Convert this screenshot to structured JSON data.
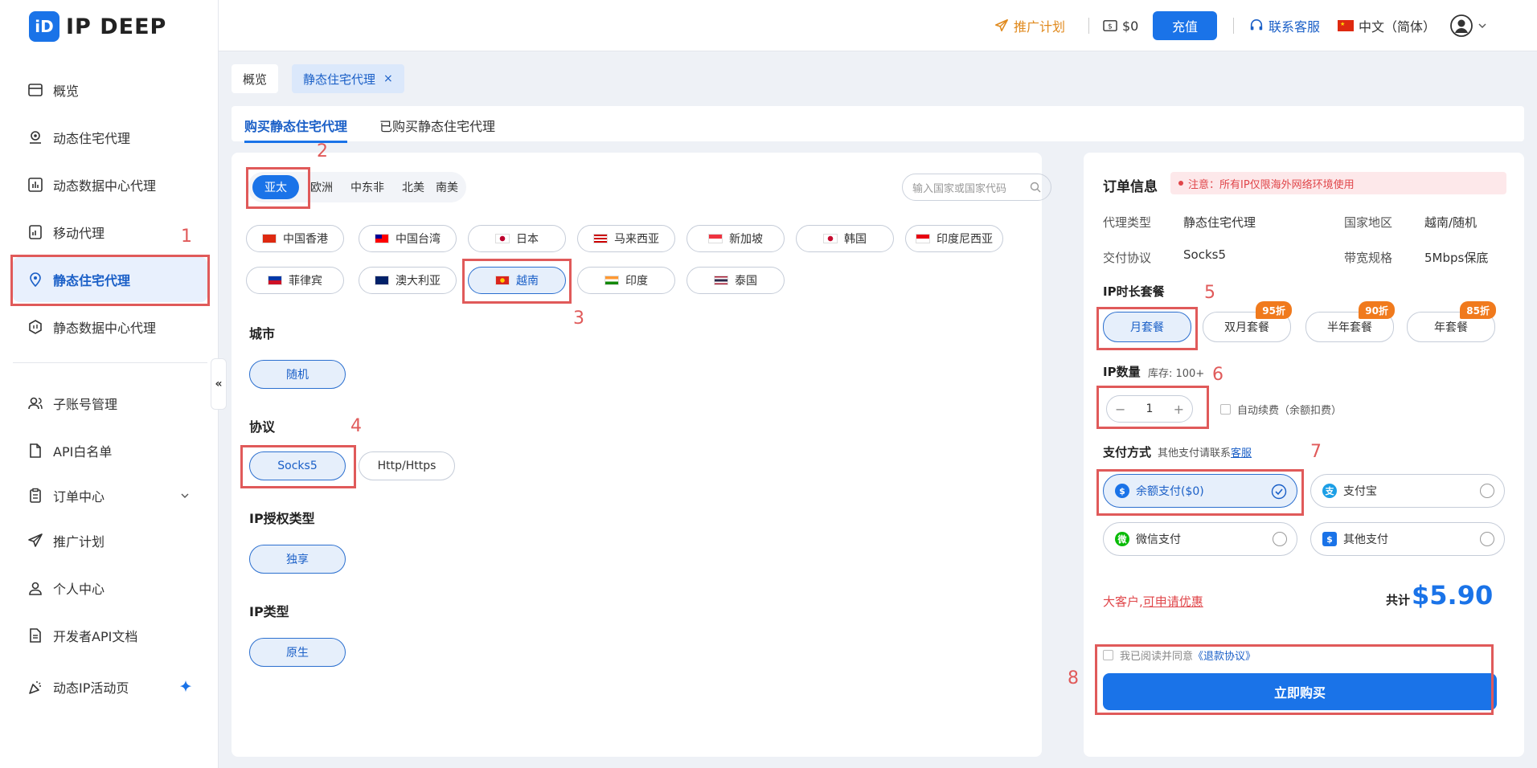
{
  "brand": {
    "logo_mark": "iD",
    "name": "IP DEEP"
  },
  "sidebar": {
    "items": [
      {
        "label": "概览",
        "icon": "dashboard-icon"
      },
      {
        "label": "动态住宅代理",
        "icon": "location-icon"
      },
      {
        "label": "动态数据中心代理",
        "icon": "chart-icon"
      },
      {
        "label": "移动代理",
        "icon": "mobile-icon"
      },
      {
        "label": "静态住宅代理",
        "icon": "pin-icon",
        "active": true
      },
      {
        "label": "静态数据中心代理",
        "icon": "hexagon-icon"
      },
      {
        "label": "子账号管理",
        "icon": "users-icon"
      },
      {
        "label": "API白名单",
        "icon": "doc-icon"
      },
      {
        "label": "订单中心",
        "icon": "clipboard-icon"
      },
      {
        "label": "推广计划",
        "icon": "send-icon"
      },
      {
        "label": "个人中心",
        "icon": "person-icon"
      },
      {
        "label": "开发者API文档",
        "icon": "file-icon"
      },
      {
        "label": "动态IP活动页",
        "icon": "party-icon"
      }
    ],
    "collapse_glyph": "«"
  },
  "topbar": {
    "promo": "推广计划",
    "balance": "$0",
    "recharge": "充值",
    "service": "联系客服",
    "language": "中文（简体）"
  },
  "page_tabs": {
    "overview": "概览",
    "current": "静态住宅代理",
    "close": "×"
  },
  "sub_tabs": {
    "buy": "购买静态住宅代理",
    "bought": "已购买静态住宅代理"
  },
  "regions": [
    "亚太",
    "欧洲",
    "中东非",
    "北美",
    "南美"
  ],
  "search": {
    "placeholder": "输入国家或国家代码"
  },
  "countries": [
    {
      "name": "中国香港",
      "flag": "hk"
    },
    {
      "name": "中国台湾",
      "flag": "tw"
    },
    {
      "name": "日本",
      "flag": "jp"
    },
    {
      "name": "马来西亚",
      "flag": "my"
    },
    {
      "name": "新加坡",
      "flag": "sg"
    },
    {
      "name": "韩国",
      "flag": "kr"
    },
    {
      "name": "印度尼西亚",
      "flag": "id"
    },
    {
      "name": "菲律宾",
      "flag": "ph"
    },
    {
      "name": "澳大利亚",
      "flag": "au"
    },
    {
      "name": "越南",
      "flag": "vn",
      "selected": true
    },
    {
      "name": "印度",
      "flag": "in"
    },
    {
      "name": "泰国",
      "flag": "th"
    }
  ],
  "city": {
    "label": "城市",
    "value": "随机"
  },
  "protocol": {
    "label": "协议",
    "options": [
      "Socks5",
      "Http/Https"
    ]
  },
  "auth": {
    "label": "IP授权类型",
    "value": "独享"
  },
  "iptype": {
    "label": "IP类型",
    "value": "原生"
  },
  "order": {
    "title": "订单信息",
    "notice": "注意：所有IP仅限海外网络环境使用",
    "proxy_type_k": "代理类型",
    "proxy_type_v": "静态住宅代理",
    "region_k": "国家地区",
    "region_v": "越南/随机",
    "protocol_k": "交付协议",
    "protocol_v": "Socks5",
    "bandwidth_k": "带宽规格",
    "bandwidth_v": "5Mbps保底",
    "plan_label": "IP时长套餐",
    "plans": [
      {
        "label": "月套餐",
        "badge": ""
      },
      {
        "label": "双月套餐",
        "badge": "95折"
      },
      {
        "label": "半年套餐",
        "badge": "90折"
      },
      {
        "label": "年套餐",
        "badge": "85折"
      }
    ],
    "qty_label": "IP数量",
    "stock": "库存: 100+",
    "qty_minus": "−",
    "qty_value": "1",
    "qty_plus": "+",
    "auto_renew": "自动续费（余额扣费）",
    "pay_label": "支付方式",
    "pay_hint": "其他支付请联系",
    "pay_hint_link": "客服",
    "payments": [
      "余额支付($0)",
      "支付宝",
      "微信支付",
      "其他支付"
    ],
    "vip": "大客户,",
    "vip_link": "可申请优惠",
    "total_label": "共计",
    "total": "$5.90",
    "agree": "我已阅读并同意",
    "agree_link": "《退款协议》",
    "buy": "立即购买"
  },
  "annotations": [
    "1",
    "2",
    "3",
    "4",
    "5",
    "6",
    "7",
    "8"
  ],
  "colors": {
    "accent": "#1a73e8",
    "annotation": "#e05a5a",
    "badge": "#f07a1d"
  }
}
